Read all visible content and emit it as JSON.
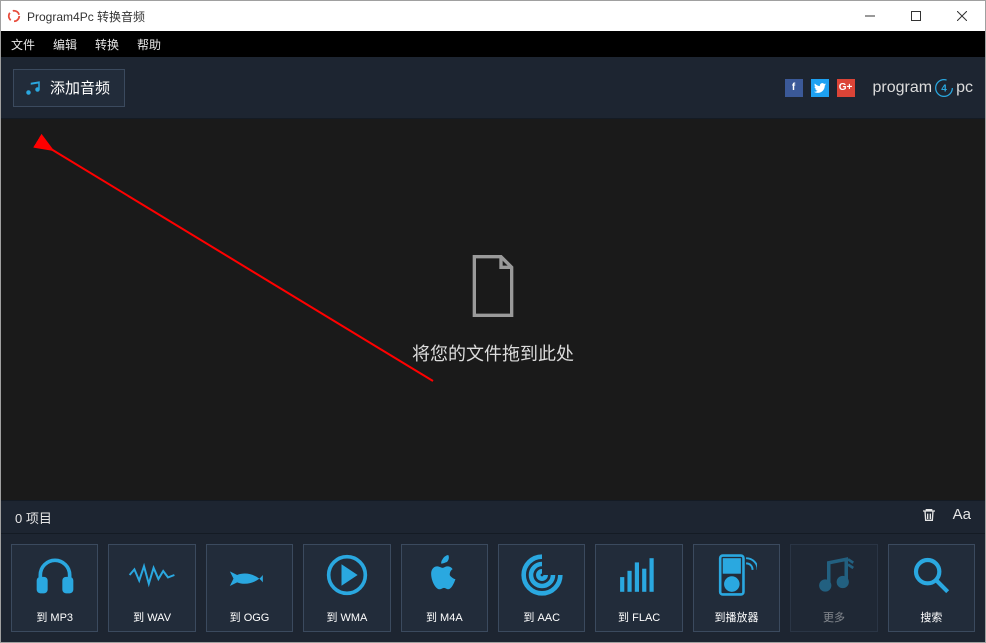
{
  "window": {
    "title": "Program4Pc 转换音频"
  },
  "menubar": {
    "file": "文件",
    "edit": "编辑",
    "convert": "转换",
    "help": "帮助"
  },
  "toolbar": {
    "add_label": "添加音频",
    "brand_prefix": "program",
    "brand_suffix": "pc"
  },
  "dropzone": {
    "text": "将您的文件拖到此处"
  },
  "status": {
    "items_label": "0 项目",
    "aa": "Aa"
  },
  "formats": [
    {
      "label": "到 MP3",
      "icon": "headphones"
    },
    {
      "label": "到 WAV",
      "icon": "waveform"
    },
    {
      "label": "到 OGG",
      "icon": "fish"
    },
    {
      "label": "到 WMA",
      "icon": "play-circle"
    },
    {
      "label": "到 M4A",
      "icon": "apple"
    },
    {
      "label": "到 AAC",
      "icon": "swirl"
    },
    {
      "label": "到 FLAC",
      "icon": "equalizer"
    },
    {
      "label": "到播放器",
      "icon": "device"
    },
    {
      "label": "更多",
      "icon": "more"
    },
    {
      "label": "搜索",
      "icon": "search"
    }
  ]
}
